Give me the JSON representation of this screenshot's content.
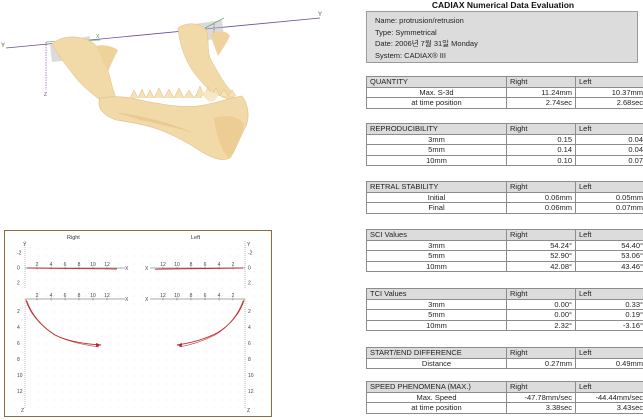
{
  "report": {
    "title": "CADIAX Numerical Data Evaluation",
    "info": {
      "name": "Name: protrusion/retrusion",
      "type": "Type: Symmetrical",
      "date": "Date: 2006년 7월 31일 Monday",
      "system": "System: CADIAX® III"
    }
  },
  "column_headers": {
    "right": "Right",
    "left": "Left"
  },
  "sections": {
    "quantity": {
      "title": "QUANTITY",
      "rows": [
        {
          "label": "Max. S-3d",
          "right": "11.24mm",
          "left": "10.37mm"
        },
        {
          "label": "at time position",
          "right": "2.74sec",
          "left": "2.68sec"
        }
      ]
    },
    "reproducibility": {
      "title": "REPRODUCIBILITY",
      "rows": [
        {
          "label": "3mm",
          "right": "0.15",
          "left": "0.04"
        },
        {
          "label": "5mm",
          "right": "0.14",
          "left": "0.04"
        },
        {
          "label": "10mm",
          "right": "0.10",
          "left": "0.07"
        }
      ]
    },
    "retral_stability": {
      "title": "RETRAL STABILITY",
      "rows": [
        {
          "label": "Initial",
          "right": "0.06mm",
          "left": "0.05mm"
        },
        {
          "label": "Final",
          "right": "0.06mm",
          "left": "0.07mm"
        }
      ]
    },
    "sci_values": {
      "title": "SCI Values",
      "rows": [
        {
          "label": "3mm",
          "right": "54.24°",
          "left": "54.40°"
        },
        {
          "label": "5mm",
          "right": "52.90°",
          "left": "53.06°"
        },
        {
          "label": "10mm",
          "right": "42.08°",
          "left": "43.46°"
        }
      ]
    },
    "tci_values": {
      "title": "TCI Values",
      "rows": [
        {
          "label": "3mm",
          "right": "0.00°",
          "left": "0.33°"
        },
        {
          "label": "5mm",
          "right": "0.00°",
          "left": "0.19°"
        },
        {
          "label": "10mm",
          "right": "2.32°",
          "left": "-3.16°"
        }
      ]
    },
    "start_end_difference": {
      "title": "START/END DIFFERENCE",
      "rows": [
        {
          "label": "Distance",
          "right": "0.27mm",
          "left": "0.49mm"
        }
      ]
    },
    "speed_phenomena": {
      "title": "SPEED PHENOMENA (MAX.)",
      "rows": [
        {
          "label": "Max. Speed",
          "right": "-47.78mm/sec",
          "left": "-44.44mm/sec"
        },
        {
          "label": "at time position",
          "right": "3.38sec",
          "left": "3.43sec"
        }
      ]
    }
  },
  "graphs": {
    "right_title": "Right",
    "left_title": "Left",
    "x_axis_label": "X",
    "y_axis_label_top": "Y",
    "z_axis_label": "Z",
    "top_y_ticks": [
      "-2",
      "0",
      "2"
    ],
    "bottom_z_ticks": [
      "2",
      "4",
      "6",
      "8",
      "10",
      "12"
    ],
    "x_ticks_right": [
      "2",
      "4",
      "6",
      "8",
      "10",
      "12"
    ],
    "x_ticks_left": [
      "12",
      "10",
      "8",
      "6",
      "4",
      "2"
    ]
  },
  "colors": {
    "bone": "#f2d9a8",
    "bone_shadow": "#e0bf86",
    "trace": "#c0282c",
    "header_bg": "#dcdcdc",
    "panel_border": "#8a6a40"
  },
  "jaw_icons": {
    "model": "mandible-3d-model-icon",
    "axis_y": "Y",
    "axis_x": "X",
    "axis_z": "Z"
  }
}
